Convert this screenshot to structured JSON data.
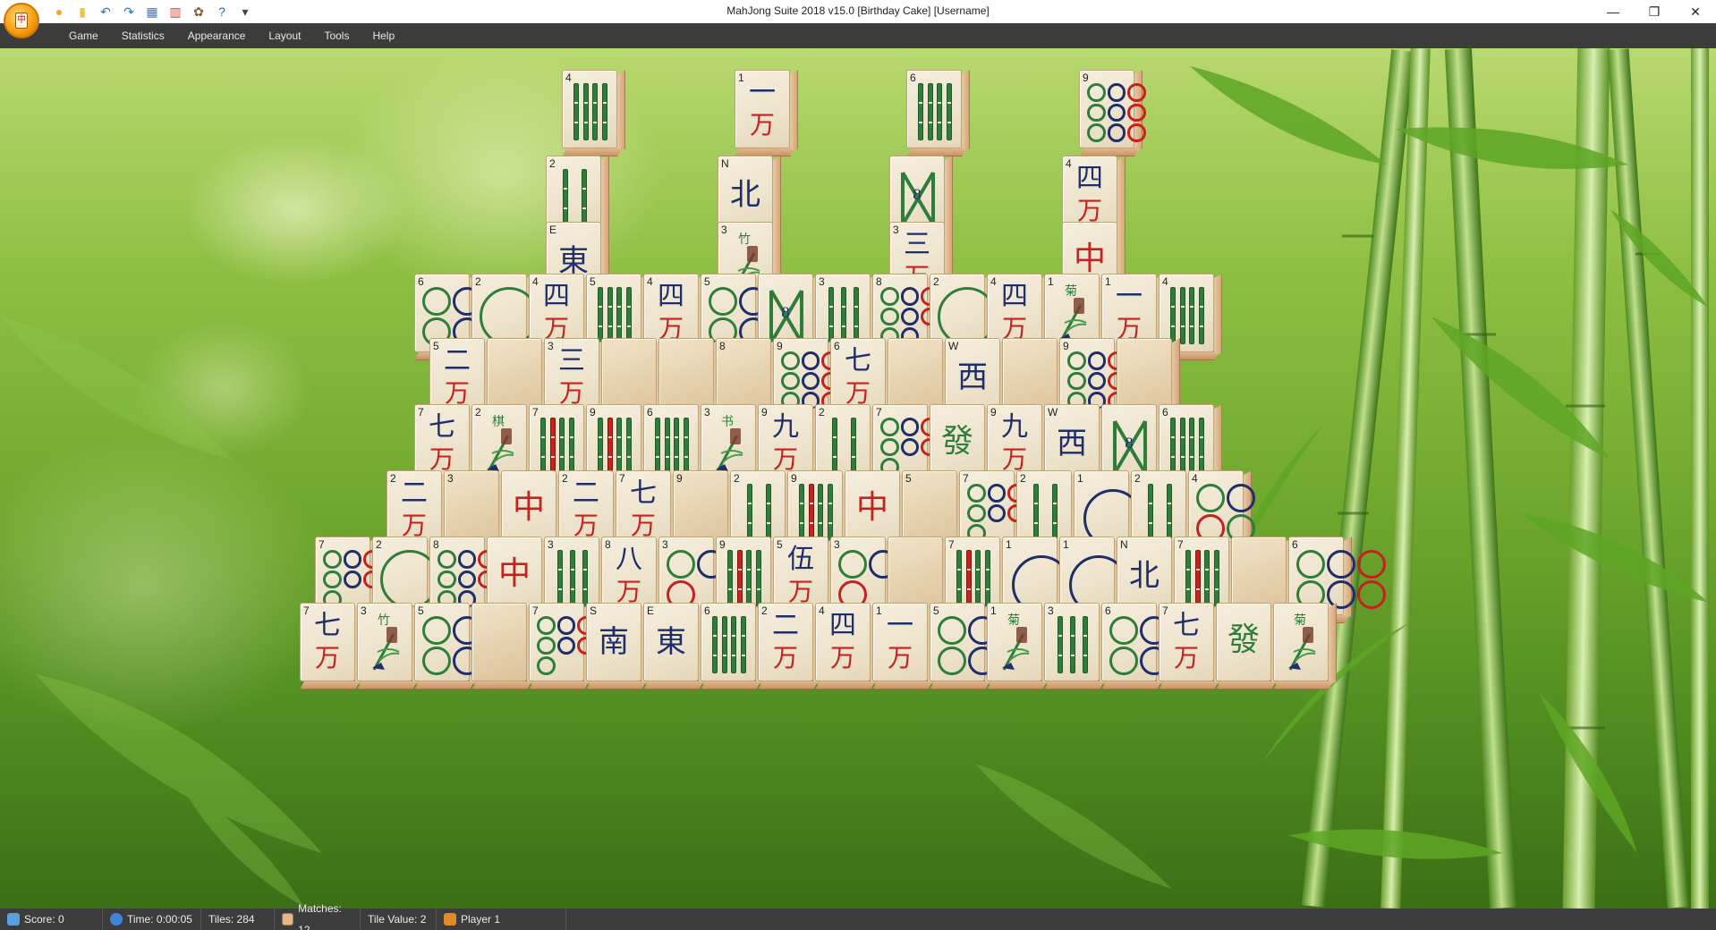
{
  "window": {
    "title": "MahJong Suite 2018 v15.0  [Birthday Cake]  [Username]",
    "controls": [
      "minimize",
      "restore",
      "close"
    ]
  },
  "quick_access": [
    {
      "name": "new-game-icon",
      "glyph": "●"
    },
    {
      "name": "open-icon",
      "glyph": "▮"
    },
    {
      "name": "undo-icon",
      "glyph": "↶"
    },
    {
      "name": "redo-icon",
      "glyph": "↷"
    },
    {
      "name": "layout-icon",
      "glyph": "▦"
    },
    {
      "name": "statistics-icon",
      "glyph": "▥"
    },
    {
      "name": "appearance-icon",
      "glyph": "✿"
    },
    {
      "name": "help-icon",
      "glyph": "?"
    },
    {
      "name": "customize-qat-icon",
      "glyph": "▾"
    }
  ],
  "menu": [
    "Game",
    "Statistics",
    "Appearance",
    "Layout",
    "Tools",
    "Help"
  ],
  "status": {
    "score": "Score: 0",
    "time": "Time: 0:00:05",
    "tiles": "Tiles: 284",
    "matches": "Matches: 12",
    "tile_value": "Tile Value: 2",
    "player": "Player 1"
  },
  "colors": {
    "menu_bg": "#3c3c3c",
    "tile_face": "#f1e9d6",
    "character_red": "#c8201c",
    "character_blue": "#1f2d6b",
    "bamboo_green": "#2f7d3a"
  },
  "tiles": [
    {
      "row": "top",
      "kind": "bamboo",
      "index": "4",
      "count": 4
    },
    {
      "row": "top",
      "kind": "char",
      "index": "1",
      "top": "一",
      "bottom": "万"
    },
    {
      "row": "top",
      "kind": "bamboo",
      "index": "6",
      "count": 6
    },
    {
      "row": "top",
      "kind": "dots",
      "index": "9",
      "count": 9
    },
    {
      "row": "tower2",
      "kind": "bamboo",
      "index": "2",
      "count": 2
    },
    {
      "row": "tower2",
      "kind": "wind",
      "index": "N",
      "top": "北"
    },
    {
      "row": "tower2",
      "kind": "bamboo8",
      "index": "",
      "label": "8"
    },
    {
      "row": "tower2",
      "kind": "char",
      "index": "4",
      "top": "四",
      "bottom": "万"
    },
    {
      "row": "tower3",
      "kind": "wind",
      "index": "E",
      "top": "東"
    },
    {
      "row": "tower3",
      "kind": "flower",
      "index": "3",
      "top": "竹"
    },
    {
      "row": "tower3",
      "kind": "char",
      "index": "3",
      "top": "三",
      "bottom": "万"
    },
    {
      "row": "tower3",
      "kind": "dragon",
      "index": "",
      "top": "中"
    },
    {
      "row": "r1",
      "kind": "dots",
      "index": "6",
      "count": 6
    },
    {
      "row": "r1",
      "kind": "dots",
      "index": "2",
      "count": 2
    },
    {
      "row": "r1",
      "kind": "char",
      "index": "4",
      "top": "四",
      "bottom": "万"
    },
    {
      "row": "r1",
      "kind": "bamboo",
      "index": "5",
      "count": 5
    },
    {
      "row": "r1",
      "kind": "char",
      "index": "4",
      "top": "四",
      "bottom": "万"
    },
    {
      "row": "r1",
      "kind": "dots",
      "index": "5",
      "count": 5
    },
    {
      "row": "r1",
      "kind": "bamboo8",
      "index": "",
      "label": "8"
    },
    {
      "row": "r1",
      "kind": "bamboo",
      "index": "3",
      "count": 3
    },
    {
      "row": "r1",
      "kind": "dots",
      "index": "8",
      "count": 8
    },
    {
      "row": "r1",
      "kind": "dots",
      "index": "2",
      "count": 2
    },
    {
      "row": "r1",
      "kind": "char",
      "index": "4",
      "top": "四",
      "bottom": "万"
    },
    {
      "row": "r1",
      "kind": "flower",
      "index": "1",
      "top": "菊"
    },
    {
      "row": "r1",
      "kind": "char",
      "index": "1",
      "top": "一",
      "bottom": "万"
    },
    {
      "row": "r1",
      "kind": "bamboo",
      "index": "4",
      "count": 4
    },
    {
      "row": "r2",
      "kind": "char",
      "index": "5",
      "top": "二",
      "bottom": "万"
    },
    {
      "row": "r2",
      "kind": "empty",
      "index": ""
    },
    {
      "row": "r2",
      "kind": "char",
      "index": "3",
      "top": "三",
      "bottom": "万"
    },
    {
      "row": "r2",
      "kind": "empty",
      "index": ""
    },
    {
      "row": "r2",
      "kind": "empty",
      "index": ""
    },
    {
      "row": "r2",
      "kind": "empty",
      "index": "8"
    },
    {
      "row": "r2",
      "kind": "dots",
      "index": "9",
      "count": 9
    },
    {
      "row": "r2",
      "kind": "char",
      "index": "6",
      "top": "七",
      "bottom": "万"
    },
    {
      "row": "r2",
      "kind": "empty",
      "index": ""
    },
    {
      "row": "r2",
      "kind": "wind",
      "index": "W",
      "top": "西"
    },
    {
      "row": "r2",
      "kind": "empty",
      "index": ""
    },
    {
      "row": "r2",
      "kind": "dots",
      "index": "9",
      "count": 9
    },
    {
      "row": "r2",
      "kind": "empty",
      "index": ""
    },
    {
      "row": "r3",
      "kind": "char",
      "index": "7",
      "top": "七",
      "bottom": "万"
    },
    {
      "row": "r3",
      "kind": "flower",
      "index": "2",
      "top": "棋"
    },
    {
      "row": "r3",
      "kind": "bamboo",
      "index": "7",
      "count": 7
    },
    {
      "row": "r3",
      "kind": "bamboo",
      "index": "9",
      "count": 9
    },
    {
      "row": "r3",
      "kind": "bamboo",
      "index": "6",
      "count": 6
    },
    {
      "row": "r3",
      "kind": "flower",
      "index": "3",
      "top": "书"
    },
    {
      "row": "r3",
      "kind": "char",
      "index": "9",
      "top": "九",
      "bottom": "万"
    },
    {
      "row": "r3",
      "kind": "bamboo",
      "index": "2",
      "count": 2
    },
    {
      "row": "r3",
      "kind": "dots",
      "index": "7",
      "count": 7
    },
    {
      "row": "r3",
      "kind": "dragon",
      "index": "",
      "top": "發"
    },
    {
      "row": "r3",
      "kind": "char",
      "index": "9",
      "top": "九",
      "bottom": "万"
    },
    {
      "row": "r3",
      "kind": "wind",
      "index": "W",
      "top": "西"
    },
    {
      "row": "r3",
      "kind": "bamboo8",
      "index": "",
      "label": "8"
    },
    {
      "row": "r3",
      "kind": "bamboo",
      "index": "6",
      "count": 6
    },
    {
      "row": "r4",
      "kind": "char",
      "index": "2",
      "top": "二",
      "bottom": "万"
    },
    {
      "row": "r4",
      "kind": "empty",
      "index": "3"
    },
    {
      "row": "r4",
      "kind": "dragon",
      "index": "",
      "top": "中"
    },
    {
      "row": "r4",
      "kind": "char",
      "index": "2",
      "top": "二",
      "bottom": "万"
    },
    {
      "row": "r4",
      "kind": "char",
      "index": "7",
      "top": "七",
      "bottom": "万"
    },
    {
      "row": "r4",
      "kind": "empty",
      "index": "9"
    },
    {
      "row": "r4",
      "kind": "bamboo",
      "index": "2",
      "count": 2
    },
    {
      "row": "r4",
      "kind": "bamboo",
      "index": "9",
      "count": 9
    },
    {
      "row": "r4",
      "kind": "dragon",
      "index": "",
      "top": "中"
    },
    {
      "row": "r4",
      "kind": "empty",
      "index": "5"
    },
    {
      "row": "r4",
      "kind": "dots",
      "index": "7",
      "count": 7
    },
    {
      "row": "r4",
      "kind": "bamboo",
      "index": "2",
      "count": 2
    },
    {
      "row": "r4",
      "kind": "dots",
      "index": "1",
      "count": 1
    },
    {
      "row": "r4",
      "kind": "bamboo",
      "index": "2",
      "count": 2
    },
    {
      "row": "r4",
      "kind": "dots",
      "index": "4",
      "count": 4
    },
    {
      "row": "r5",
      "kind": "dots",
      "index": "7",
      "count": 7
    },
    {
      "row": "r5",
      "kind": "dots",
      "index": "2",
      "count": 2
    },
    {
      "row": "r5",
      "kind": "dots",
      "index": "8",
      "count": 8
    },
    {
      "row": "r5",
      "kind": "dragon",
      "index": "",
      "top": "中"
    },
    {
      "row": "r5",
      "kind": "bamboo",
      "index": "3",
      "count": 3
    },
    {
      "row": "r5",
      "kind": "char",
      "index": "8",
      "top": "八",
      "bottom": "万"
    },
    {
      "row": "r5",
      "kind": "dots",
      "index": "3",
      "count": 3
    },
    {
      "row": "r5",
      "kind": "bamboo",
      "index": "9",
      "count": 9
    },
    {
      "row": "r5",
      "kind": "char",
      "index": "5",
      "top": "伍",
      "bottom": "万"
    },
    {
      "row": "r5",
      "kind": "dots",
      "index": "3",
      "count": 3
    },
    {
      "row": "r5",
      "kind": "empty",
      "index": ""
    },
    {
      "row": "r5",
      "kind": "bamboo",
      "index": "7",
      "count": 7
    },
    {
      "row": "r5",
      "kind": "dots",
      "index": "1",
      "count": 1
    },
    {
      "row": "r5",
      "kind": "dots",
      "index": "1",
      "count": 1
    },
    {
      "row": "r5",
      "kind": "wind",
      "index": "N",
      "top": "北"
    },
    {
      "row": "r5",
      "kind": "bamboo",
      "index": "7",
      "count": 7
    },
    {
      "row": "r5",
      "kind": "empty",
      "index": ""
    },
    {
      "row": "r5",
      "kind": "dots",
      "index": "6",
      "count": 6
    },
    {
      "row": "r6",
      "kind": "char",
      "index": "7",
      "top": "七",
      "bottom": "万"
    },
    {
      "row": "r6",
      "kind": "flower",
      "index": "3",
      "top": "竹"
    },
    {
      "row": "r6",
      "kind": "dots",
      "index": "5",
      "count": 5
    },
    {
      "row": "r6",
      "kind": "empty",
      "index": ""
    },
    {
      "row": "r6",
      "kind": "dots",
      "index": "7",
      "count": 7
    },
    {
      "row": "r6",
      "kind": "wind",
      "index": "S",
      "top": "南"
    },
    {
      "row": "r6",
      "kind": "wind",
      "index": "E",
      "top": "東"
    },
    {
      "row": "r6",
      "kind": "bamboo",
      "index": "6",
      "count": 6
    },
    {
      "row": "r6",
      "kind": "char",
      "index": "2",
      "top": "二",
      "bottom": "万"
    },
    {
      "row": "r6",
      "kind": "char",
      "index": "4",
      "top": "四",
      "bottom": "万"
    },
    {
      "row": "r6",
      "kind": "char",
      "index": "1",
      "top": "一",
      "bottom": "万"
    },
    {
      "row": "r6",
      "kind": "dots",
      "index": "5",
      "count": 5
    },
    {
      "row": "r6",
      "kind": "flower",
      "index": "1",
      "top": "菊"
    },
    {
      "row": "r6",
      "kind": "bamboo",
      "index": "3",
      "count": 3
    },
    {
      "row": "r6",
      "kind": "dots",
      "index": "6",
      "count": 6
    },
    {
      "row": "r6",
      "kind": "char",
      "index": "7",
      "top": "七",
      "bottom": "万"
    },
    {
      "row": "r6",
      "kind": "dragon",
      "index": "",
      "top": "發"
    },
    {
      "row": "r6",
      "kind": "flower",
      "index": "",
      "top": "菊"
    }
  ]
}
